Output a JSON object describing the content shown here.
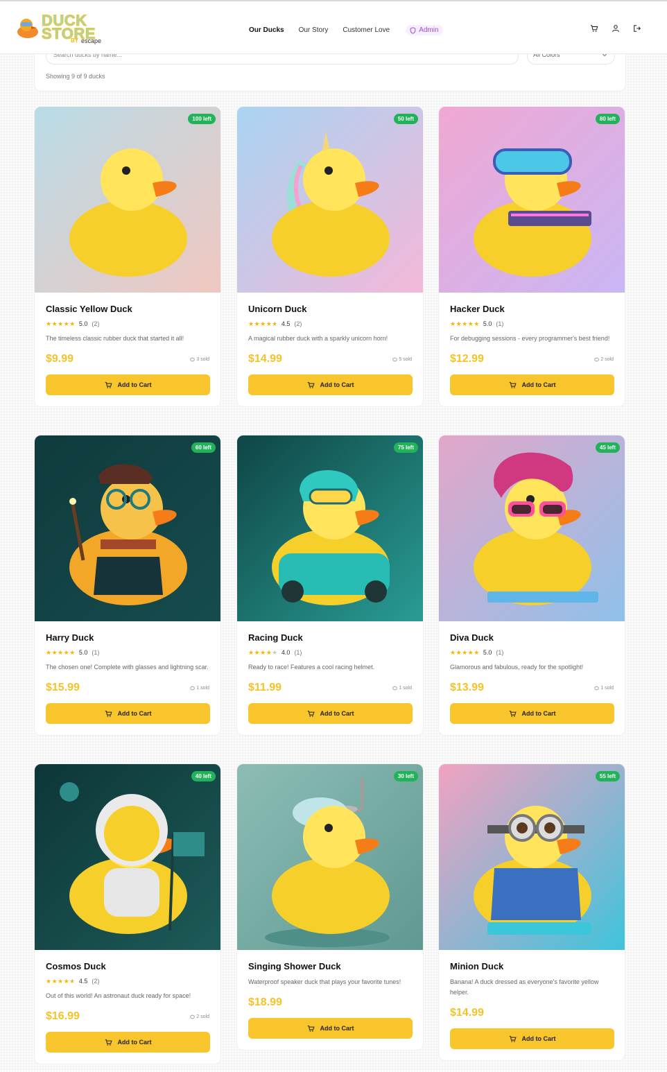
{
  "brand": {
    "logo_line1": "DUCK",
    "logo_line2": "STORE",
    "by": "BY",
    "partner": "escape"
  },
  "nav": {
    "items": [
      {
        "label": "Our Ducks",
        "active": true
      },
      {
        "label": "Our Story",
        "active": false
      },
      {
        "label": "Customer Love",
        "active": false
      }
    ],
    "admin_label": "Admin"
  },
  "header_icons": [
    "cart-icon",
    "user-icon",
    "logout-icon"
  ],
  "filter": {
    "search_placeholder": "Search ducks by name...",
    "color_selected": "All Colors",
    "showing_text": "Showing 9 of 9 ducks"
  },
  "colors": {
    "accent": "#f9c52c",
    "price": "#f5c227",
    "stock_badge": "#22b35a",
    "admin": "#a04bd1"
  },
  "add_to_cart_label": "Add to Cart",
  "products": [
    {
      "name": "Classic Yellow Duck",
      "stock": "100 left",
      "stars": 5,
      "rating": "5.0",
      "reviews": "(2)",
      "description": "The timeless classic rubber duck that started it all!",
      "price": "$9.99",
      "sold": "3 sold",
      "bg1": "#b8dbe6",
      "bg2": "#f1c7c0",
      "theme": "classic"
    },
    {
      "name": "Unicorn Duck",
      "stock": "50 left",
      "stars": 4.5,
      "rating": "4.5",
      "reviews": "(2)",
      "description": "A magical rubber duck with a sparkly unicorn horn!",
      "price": "$14.99",
      "sold": "5 sold",
      "bg1": "#a9d4f2",
      "bg2": "#f4b7d8",
      "theme": "unicorn"
    },
    {
      "name": "Hacker Duck",
      "stock": "80 left",
      "stars": 5,
      "rating": "5.0",
      "reviews": "(1)",
      "description": "For debugging sessions - every programmer's best friend!",
      "price": "$12.99",
      "sold": "2 sold",
      "bg1": "#f0a8d2",
      "bg2": "#c9b6f4",
      "theme": "hacker"
    },
    {
      "name": "Harry Duck",
      "stock": "60 left",
      "stars": 5,
      "rating": "5.0",
      "reviews": "(1)",
      "description": "The chosen one! Complete with glasses and lightning scar.",
      "price": "$15.99",
      "sold": "1 sold",
      "bg1": "#0f3b3d",
      "bg2": "#164c4d",
      "theme": "harry"
    },
    {
      "name": "Racing Duck",
      "stock": "75 left",
      "stars": 4,
      "rating": "4.0",
      "reviews": "(1)",
      "description": "Ready to race! Features a cool racing helmet.",
      "price": "$11.99",
      "sold": "1 sold",
      "bg1": "#0e4645",
      "bg2": "#2a9c95",
      "theme": "racing"
    },
    {
      "name": "Diva Duck",
      "stock": "45 left",
      "stars": 5,
      "rating": "5.0",
      "reviews": "(1)",
      "description": "Glamorous and fabulous, ready for the spotlight!",
      "price": "$13.99",
      "sold": "1 sold",
      "bg1": "#e3a6c9",
      "bg2": "#8fc1ea",
      "theme": "diva"
    },
    {
      "name": "Cosmos Duck",
      "stock": "40 left",
      "stars": 4.5,
      "rating": "4.5",
      "reviews": "(2)",
      "description": "Out of this world! An astronaut duck ready for space!",
      "price": "$16.99",
      "sold": "2 sold",
      "bg1": "#0d3638",
      "bg2": "#1d5b58",
      "theme": "cosmos"
    },
    {
      "name": "Singing Shower Duck",
      "stock": "30 left",
      "stars": 0,
      "rating": "",
      "reviews": "",
      "description": "Waterproof speaker duck that plays your favorite tunes!",
      "price": "$18.99",
      "sold": "",
      "bg1": "#8cbdb5",
      "bg2": "#5f9991",
      "theme": "shower"
    },
    {
      "name": "Minion Duck",
      "stock": "55 left",
      "stars": 0,
      "rating": "",
      "reviews": "",
      "description": "Banana! A duck dressed as everyone's favorite yellow helper.",
      "price": "$14.99",
      "sold": "",
      "bg1": "#f2a2c1",
      "bg2": "#3fc3dc",
      "theme": "minion"
    }
  ]
}
